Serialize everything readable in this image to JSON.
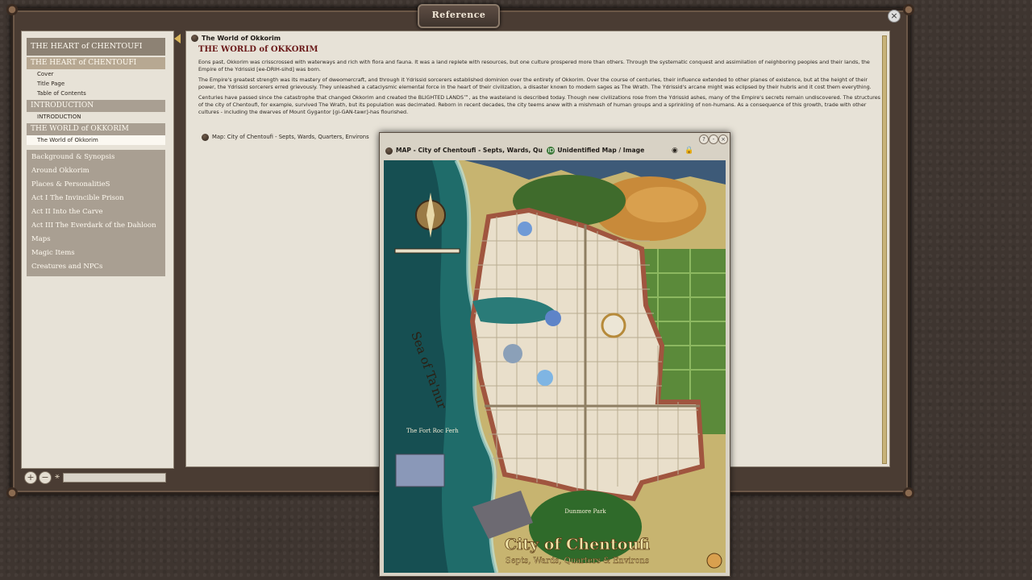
{
  "window": {
    "title": "Reference",
    "close_icon": "×"
  },
  "sidebar": {
    "top_heading": "THE HEART of CHENTOUFI",
    "sections": [
      {
        "label": "THE HEART of CHENTOUFI",
        "items": [
          "Cover",
          "Title Page",
          "Table of Contents"
        ]
      },
      {
        "label": "INTRODUCTION",
        "items": [
          "INTRODUCTION"
        ]
      },
      {
        "label": "THE WORLD of OKKORIM",
        "items": [
          "The World of Okkorim"
        ]
      }
    ],
    "categories": [
      "Background & Synopsis",
      "Around Okkorim",
      "Places & PersonalitieS",
      "Act I The Invincible Prison",
      "Act II Into the Carve",
      "Act III The Everdark of the Dahloon",
      "Maps",
      "Magic Items",
      "Creatures and NPCs"
    ],
    "add_icon": "+",
    "remove_icon": "−"
  },
  "content": {
    "page_title": "The World of Okkorim",
    "heading": "THE WORLD of OKKORIM",
    "paragraphs": [
      "Eons past, Okkorim was crisscrossed with waterways and rich with flora and fauna. It was a land replete with resources, but one culture prospered more than others. Through the systematic conquest and assimilation of neighboring peoples and their lands, the Empire of the Ydrissid [ee-DRIH-sihd] was born.",
      "The Empire's greatest strength was its mastery of dweomercraft, and through it Ydrissid sorcerers established dominion over the entirety of Okkorim. Over the course of centuries, their influence extended to other planes of existence, but at the height of their power, the Ydrissid sorcerers erred grievously. They unleashed a cataclysmic elemental force in the heart of their civilization, a disaster known to modern sages as The Wrath. The Ydrissid's arcane might was eclipsed by their hubris and it cost them everything.",
      "Centuries have passed since the catastrophe that changed Okkorim and created the BLIGHTED LANDS™, as the wasteland is described today. Though new civilizations rose from the Ydrissid ashes, many of the Empire's secrets remain undiscovered. The structures of the city of Chentoufi, for example, survived The Wrath, but its population was decimated. Reborn in recent decades, the city teems anew with a mishmash of human groups and a sprinkling of non-humans. As a consequence of this growth, trade with other cultures - including the dwarves of Mount Gygantor [gi-GAN-tawr]-has flourished."
    ],
    "map_link": "Map: City of Chentoufi - Septs, Wards, Quarters, Environs"
  },
  "map_window": {
    "title": "MAP - City of Chentoufi - Septs, Wards, Qu",
    "status": "Unidentified Map / Image",
    "id_icon": "ID",
    "map": {
      "sea_label": "Sea of Ta'nur",
      "city_title": "City of Chentoufi",
      "city_subtitle": "Septs, Wards, Quarters & Environs",
      "fort_label": "The Fort Roc Ferh",
      "district_label": "Dunmore Park"
    }
  },
  "colors": {
    "heading": "#6b1a1a",
    "sidebar_head": "#a99f92",
    "sea": "#1f6c6a",
    "land": "#c9b774",
    "city": "#e9dfcb",
    "wall": "#a0553f"
  }
}
